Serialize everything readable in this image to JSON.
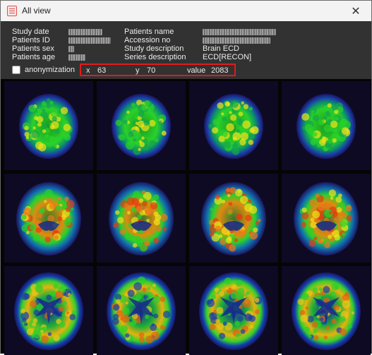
{
  "window": {
    "title": "All view",
    "close_glyph": "✕",
    "app_icon": "image-list-icon"
  },
  "info": {
    "study_date_label": "Study date",
    "patients_id_label": "Patients ID",
    "patients_sex_label": "Patients sex",
    "patients_age_label": "Patients age",
    "patients_name_label": "Patients name",
    "accession_no_label": "Accession no",
    "study_description_label": "Study  description",
    "study_description_value": "Brain ECD",
    "series_description_label": "Series description",
    "series_description_value": "ECD[RECON]"
  },
  "anonymization": {
    "label": "anonymization",
    "checked": false
  },
  "cursor": {
    "x_label": "x",
    "x_value": "63",
    "y_label": "y",
    "y_value": "70",
    "value_label": "value",
    "value_value": "2083",
    "highlight_color": "#e01b1b"
  },
  "slices": {
    "rows": 3,
    "cols": 4,
    "colormap": "rainbow",
    "background": "#050505"
  }
}
